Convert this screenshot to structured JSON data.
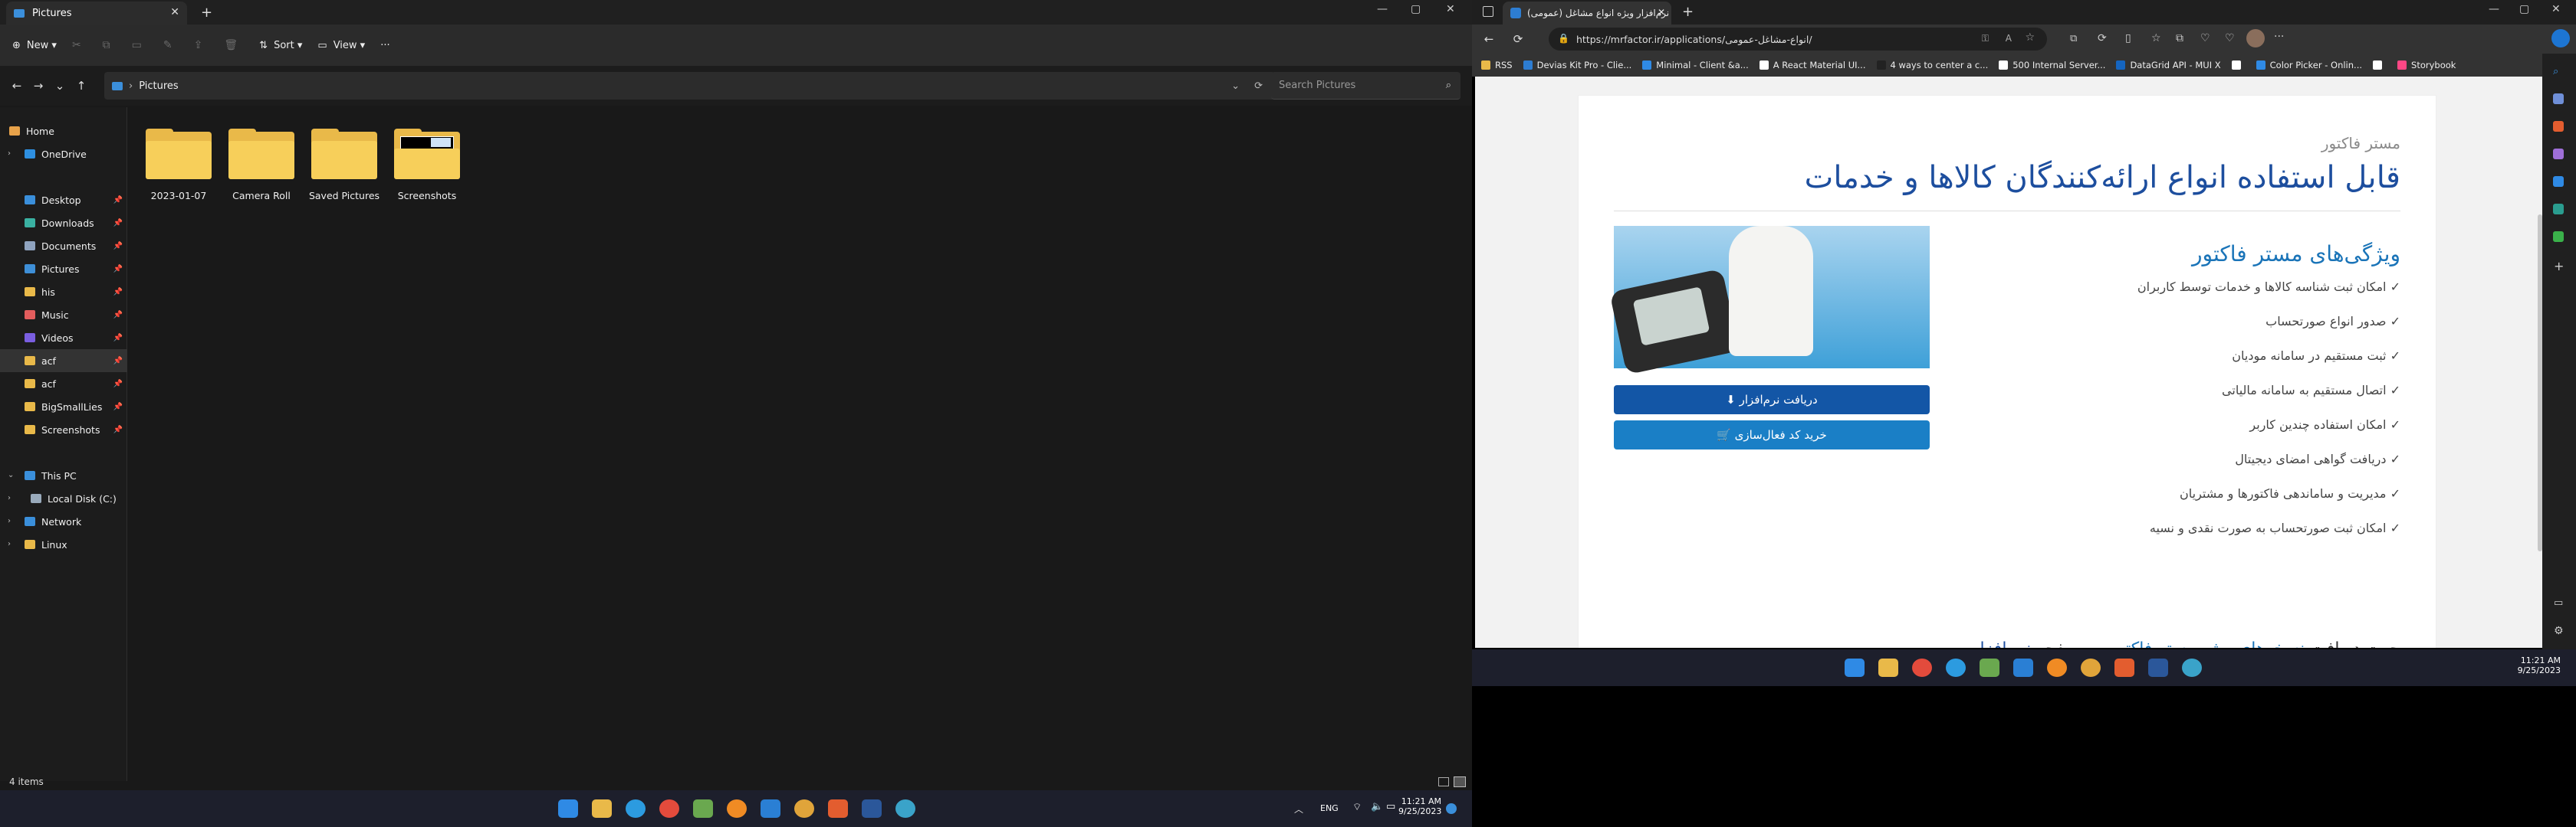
{
  "explorer": {
    "tab_title": "Pictures",
    "cmd": {
      "new": "New",
      "sort": "Sort",
      "view": "View",
      "more": "···"
    },
    "address": "Pictures",
    "search_placeholder": "Search Pictures",
    "sidebar": [
      {
        "label": "Home",
        "icon": "home-icon",
        "color": "#e7a24a"
      },
      {
        "label": "OneDrive",
        "icon": "cloud-icon",
        "color": "#2e8fe0"
      },
      {
        "label": "Desktop",
        "icon": "desktop-icon",
        "color": "#3a8fdb",
        "pinned": true
      },
      {
        "label": "Downloads",
        "icon": "download-icon",
        "color": "#3ab1a2",
        "pinned": true
      },
      {
        "label": "Documents",
        "icon": "document-icon",
        "color": "#8fa3bf",
        "pinned": true
      },
      {
        "label": "Pictures",
        "icon": "picture-icon",
        "color": "#3e8fd7",
        "pinned": true
      },
      {
        "label": "his",
        "icon": "folder-icon",
        "color": "#e9b949",
        "pinned": true
      },
      {
        "label": "Music",
        "icon": "music-icon",
        "color": "#e35d5d",
        "pinned": true
      },
      {
        "label": "Videos",
        "icon": "video-icon",
        "color": "#7a5ee0",
        "pinned": true
      },
      {
        "label": "acf",
        "icon": "folder-icon",
        "color": "#e9b949",
        "pinned": true,
        "selected": true
      },
      {
        "label": "acf",
        "icon": "folder-icon",
        "color": "#e9b949",
        "pinned": true
      },
      {
        "label": "BigSmallLies",
        "icon": "folder-icon",
        "color": "#e9b949",
        "pinned": true
      },
      {
        "label": "Screenshots",
        "icon": "folder-icon",
        "color": "#e9b949",
        "pinned": true
      },
      {
        "label": "This PC",
        "icon": "pc-icon",
        "color": "#3a8fdb"
      },
      {
        "label": "Local Disk (C:)",
        "icon": "disk-icon",
        "color": "#9ab"
      },
      {
        "label": "Network",
        "icon": "network-icon",
        "color": "#3a8fdb"
      },
      {
        "label": "Linux",
        "icon": "linux-icon",
        "color": "#e9b949"
      }
    ],
    "folders": [
      "2023-01-07",
      "Camera Roll",
      "Saved Pictures",
      "Screenshots"
    ],
    "status": "4 items",
    "taskbar": {
      "time": "11:21 AM",
      "date": "9/25/2023",
      "lang": "ENG"
    }
  },
  "edge": {
    "tab_title": "نرم‌افزار ویژه انواع مشاغل (عمومی)",
    "url": "https://mrfactor.ir/applications/انواع-مشاغل-عمومی/",
    "favorites": [
      "RSS",
      "Devias Kit Pro - Clie...",
      "Minimal - Client &a...",
      "A React Material UI...",
      "4 ways to center a c...",
      "500 Internal Server...",
      "DataGrid API - MUI X",
      "",
      "Color Picker - Onlin...",
      "",
      "Storybook"
    ],
    "page": {
      "subtitle": "مستر فاکتور",
      "title": "قابل استفاده انواع ارائه‌کنندگان کالاها و خدمات",
      "features_title": "ویژگی‌های مستر فاکتور",
      "features": [
        "✓ امکان ثبت شناسه کالاها و خدمات توسط کاربران",
        "✓ صدور انواع صورتحساب",
        "✓ ثبت مستقیم در سامانه مودیان",
        "✓ اتصال مستقیم به سامانه مالیاتی",
        "✓ امکان استفاده چندین کاربر",
        "✓ دریافت گواهی امضای دیجیتال",
        "✓ مدیریت و ساماندهی فاکتورها و مشتریان",
        "✓ امکان ثبت صورتحساب به صورت نقدی و نسیه"
      ],
      "download_btn": "دریافت نرم‌افزار",
      "buy_btn": "خرید کد فعال‌سازی",
      "bottom_prefix": "جهت دریافت ",
      "bottom_link": "نسخه‌های ویژه مستر فاکتور",
      "bottom_mid": "، به صفحه ",
      "bottom_under": "نرم‌افزار"
    },
    "taskbar": {
      "time": "11:21 AM",
      "date": "9/25/2023"
    }
  }
}
